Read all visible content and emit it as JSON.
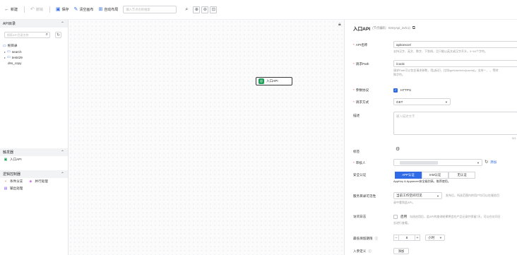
{
  "toolbar": {
    "new": "新建",
    "undo": "撤销",
    "save": "保存",
    "clear": "清空画布",
    "auto_layout": "自动布局",
    "search_placeholder": "输入节点名称搜索"
  },
  "left": {
    "api_section": "API目录",
    "search_placeholder": "搜索API目录名称",
    "tree": [
      {
        "label": "根目录",
        "expandable": false
      },
      {
        "label": "search",
        "expandable": true
      },
      {
        "label": "test429",
        "expandable": true
      },
      {
        "label": "dss_copy",
        "expandable": false
      }
    ],
    "trigger_section": "触发器",
    "trigger_items": [
      "入口API"
    ],
    "logic_section": "逻辑控制器",
    "logic_items": [
      "条件分支",
      "并行处理",
      "输出处理"
    ]
  },
  "canvas": {
    "node_label": "入口API"
  },
  "right": {
    "title": "入口API",
    "title_sub": "(节点编码：EntryApi_2ufc1)",
    "api_name_label": "API名称",
    "api_name_value": "apitoexcel",
    "api_name_hint": "支持汉字、英文、数字、下划线，且只能以英文或汉字开头，3~64个字符。",
    "path_label": "请求Path",
    "path_value": "/coolc",
    "path_hint_1": "请求Path可以包含请求参数，用{}标识，比如/getUserInfo/{userId}，支持 * 、.、等特",
    "path_hint_2": "殊字符。",
    "protocol_label": "参数协议",
    "protocol_value": "HTTPS",
    "method_label": "请求方式",
    "method_value": "GET",
    "desc_label": "描述",
    "desc_placeholder": "输入描述文字",
    "desc_counter": "0/1",
    "tag_label": "标签",
    "reviewer_label": "审核人",
    "reviewer_link": "添加",
    "auth_label": "安全认证",
    "auth_options": [
      "APP认证",
      "IAM认证",
      "无认证"
    ],
    "auth_hint": "AppKey & Appsecret安全级别高，推荐使用。",
    "visibility_label": "服务目录可见性",
    "visibility_value": "当前工作空间可见",
    "visibility_hint_side": "发布后，所选范围内的用户均可以在服务目",
    "visibility_hint": "录中看到此API。",
    "log_label": "访问日志",
    "log_option": "启用",
    "log_hint_1": "勾选启用后，此API的查询结果将会在产品记录并保留7天，可以在访问日",
    "log_hint_2": "志进行查看。",
    "retention_label": "最低保留期限",
    "retention_value": "8",
    "retention_unit": "小时",
    "input_params_label": "入参定义",
    "add_button": "添加"
  }
}
